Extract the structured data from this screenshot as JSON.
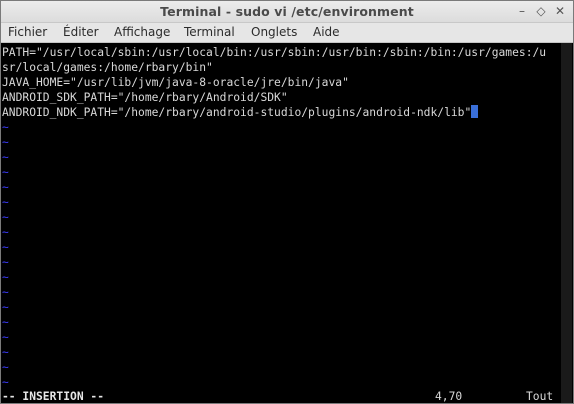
{
  "window": {
    "title": "Terminal - sudo vi /etc/environment",
    "controls": {
      "minimize": "–",
      "maximize": "◇",
      "close": "✕"
    }
  },
  "menu": {
    "items": [
      "Fichier",
      "Éditer",
      "Affichage",
      "Terminal",
      "Onglets",
      "Aide"
    ]
  },
  "editor": {
    "lines": [
      "PATH=\"/usr/local/sbin:/usr/local/bin:/usr/sbin:/usr/bin:/sbin:/bin:/usr/games:/u",
      "sr/local/games:/home/rbary/bin\"",
      "JAVA_HOME=\"/usr/lib/jvm/java-8-oracle/jre/bin/java\"",
      "ANDROID_SDK_PATH=\"/home/rbary/Android/SDK\"",
      "ANDROID_NDK_PATH=\"/home/rbary/android-studio/plugins/android-ndk/lib\""
    ],
    "tilde": "~",
    "empty_line_count": 18,
    "status": {
      "mode": "-- INSERTION --",
      "position": "4,70",
      "scroll": "Tout"
    }
  },
  "colors": {
    "background": "#000000",
    "text": "#d8d8d8",
    "tilde": "#3d3dff",
    "cursor": "#3a6fd8"
  }
}
